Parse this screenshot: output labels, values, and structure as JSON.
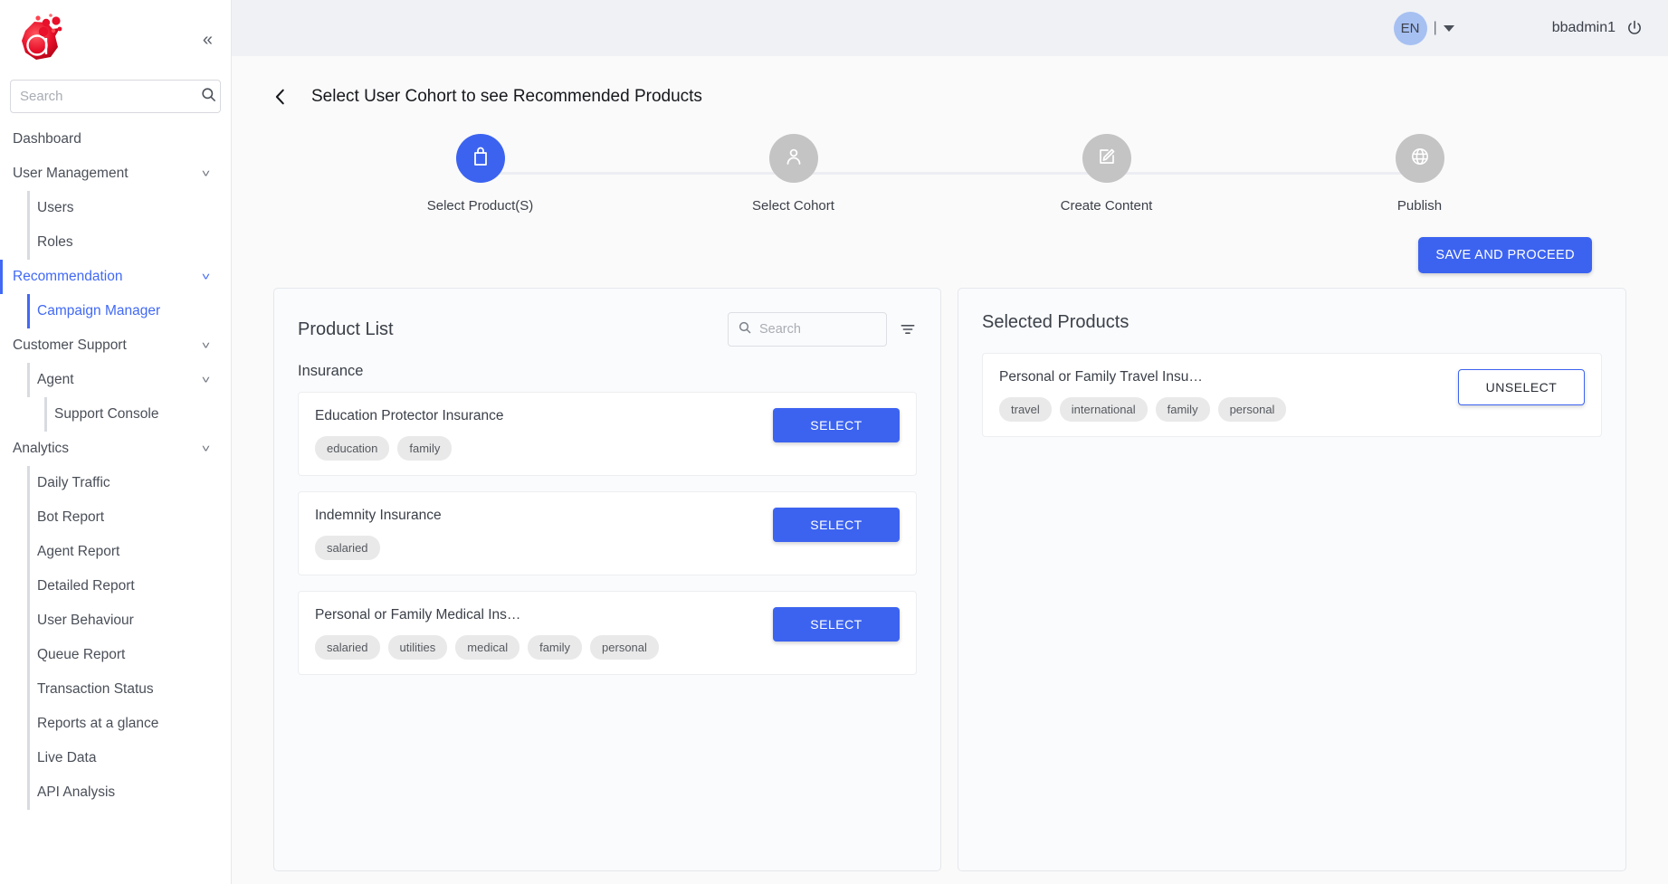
{
  "sidebar": {
    "logo_name": "app-logo",
    "collapse_label": "«",
    "search": {
      "placeholder": "Search",
      "value": ""
    },
    "items": [
      {
        "label": "Dashboard",
        "level": 0,
        "chevron": false,
        "active": false,
        "rail": "none"
      },
      {
        "label": "User Management",
        "level": 0,
        "chevron": true,
        "active": false,
        "rail": "none"
      },
      {
        "label": "Users",
        "level": 1,
        "chevron": false,
        "active": false,
        "rail": "grey"
      },
      {
        "label": "Roles",
        "level": 1,
        "chevron": false,
        "active": false,
        "rail": "grey"
      },
      {
        "label": "Recommendation",
        "level": 0,
        "chevron": true,
        "active": true,
        "rail": "blue"
      },
      {
        "label": "Campaign Manager",
        "level": 1,
        "chevron": false,
        "active": true,
        "rail": "blue1"
      },
      {
        "label": "Customer Support",
        "level": 0,
        "chevron": true,
        "active": false,
        "rail": "none"
      },
      {
        "label": "Agent",
        "level": 1,
        "chevron": true,
        "active": false,
        "rail": "grey"
      },
      {
        "label": "Support Console",
        "level": 2,
        "chevron": false,
        "active": false,
        "rail": "grey2"
      },
      {
        "label": "Analytics",
        "level": 0,
        "chevron": true,
        "active": false,
        "rail": "none"
      },
      {
        "label": "Daily Traffic",
        "level": 1,
        "chevron": false,
        "active": false,
        "rail": "grey"
      },
      {
        "label": "Bot Report",
        "level": 1,
        "chevron": false,
        "active": false,
        "rail": "grey"
      },
      {
        "label": "Agent Report",
        "level": 1,
        "chevron": false,
        "active": false,
        "rail": "grey"
      },
      {
        "label": "Detailed Report",
        "level": 1,
        "chevron": false,
        "active": false,
        "rail": "grey"
      },
      {
        "label": "User Behaviour",
        "level": 1,
        "chevron": false,
        "active": false,
        "rail": "grey"
      },
      {
        "label": "Queue Report",
        "level": 1,
        "chevron": false,
        "active": false,
        "rail": "grey"
      },
      {
        "label": "Transaction Status",
        "level": 1,
        "chevron": false,
        "active": false,
        "rail": "grey"
      },
      {
        "label": "Reports at a glance",
        "level": 1,
        "chevron": false,
        "active": false,
        "rail": "grey"
      },
      {
        "label": "Live Data",
        "level": 1,
        "chevron": false,
        "active": false,
        "rail": "grey"
      },
      {
        "label": "API Analysis",
        "level": 1,
        "chevron": false,
        "active": false,
        "rail": "grey"
      }
    ]
  },
  "topbar": {
    "language": "EN",
    "separator": "|",
    "username": "bbadmin1"
  },
  "page": {
    "title": "Select User Cohort to see Recommended Products",
    "save_label": "SAVE AND PROCEED"
  },
  "stepper": {
    "steps": [
      {
        "label": "Select Product(S)",
        "icon": "briefcase-icon",
        "state": "current"
      },
      {
        "label": "Select Cohort",
        "icon": "person-icon",
        "state": "pending"
      },
      {
        "label": "Create Content",
        "icon": "edit-icon",
        "state": "pending"
      },
      {
        "label": "Publish",
        "icon": "globe-icon",
        "state": "pending"
      }
    ]
  },
  "product_list": {
    "title": "Product List",
    "search": {
      "placeholder": "Search",
      "value": ""
    },
    "group_title": "Insurance",
    "select_label": "SELECT",
    "products": [
      {
        "name": "Education Protector Insurance",
        "tags": [
          "education",
          "family"
        ]
      },
      {
        "name": "Indemnity Insurance",
        "tags": [
          "salaried"
        ]
      },
      {
        "name": "Personal or Family Medical Ins…",
        "tags": [
          "salaried",
          "utilities",
          "medical",
          "family",
          "personal"
        ]
      }
    ]
  },
  "selected_products": {
    "title": "Selected Products",
    "unselect_label": "UNSELECT",
    "products": [
      {
        "name": "Personal or Family Travel Insu…",
        "tags": [
          "travel",
          "international",
          "family",
          "personal"
        ]
      }
    ]
  },
  "colors": {
    "accent": "#3c63f0",
    "topbar_bg": "#eff1f5",
    "content_bg": "#fafafa",
    "step_inactive": "#c4c4c4",
    "tag_bg": "#e9e9e9",
    "logo_red": "#e8102a"
  }
}
